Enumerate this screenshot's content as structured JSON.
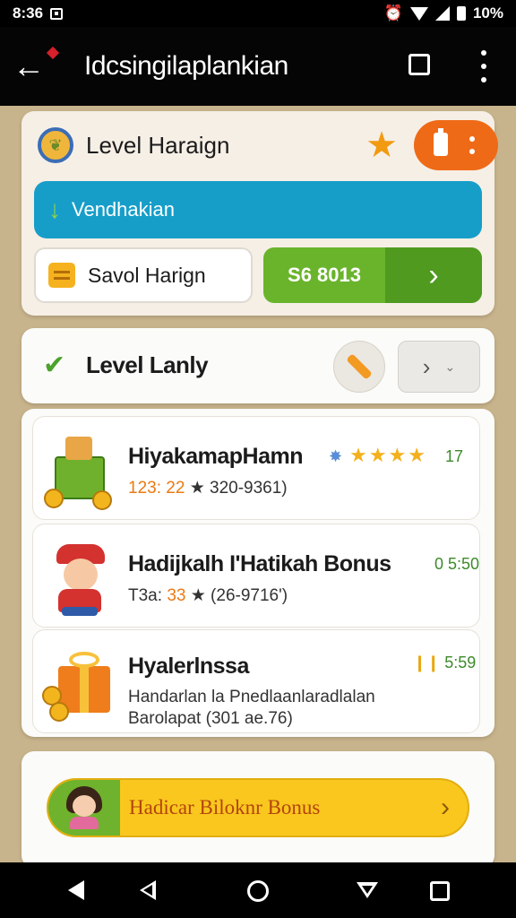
{
  "status_bar": {
    "time": "8:36",
    "battery": "10%"
  },
  "app_bar": {
    "title": "Idcsingilaplankian"
  },
  "level_card": {
    "title": "Level Haraign",
    "download_label": "Vendhakian",
    "save_label": "Savol Harign",
    "green_value": "S6 8013"
  },
  "level_lanly": {
    "title": "Level Lanly"
  },
  "list": {
    "items": [
      {
        "title": "HiyakamapHamn",
        "sub_prefix": "123: 22",
        "sub_rest": "★ 320-9361)",
        "stars": "★★★★",
        "meta": "17"
      },
      {
        "title": "Hadijkalh I'Hatikah Bonus",
        "sub_prefix": "T3a: ",
        "sub_orange": "33",
        "sub_rest": "★ (26-9716')",
        "meta": "0 5:50"
      },
      {
        "title": "Hyalerlnssa",
        "line1": "Handarlan la Pnedlaanlaradlalan",
        "line2": "Barolapat (301 ae.76)",
        "meta": "5:59"
      }
    ]
  },
  "bonus": {
    "label": "Hadicar Biloknr Bonus"
  },
  "colors": {
    "accent_blue": "#169ec9",
    "accent_green": "#6ab42c",
    "accent_orange": "#ef6a17",
    "bonus_yellow": "#f9c71d"
  }
}
